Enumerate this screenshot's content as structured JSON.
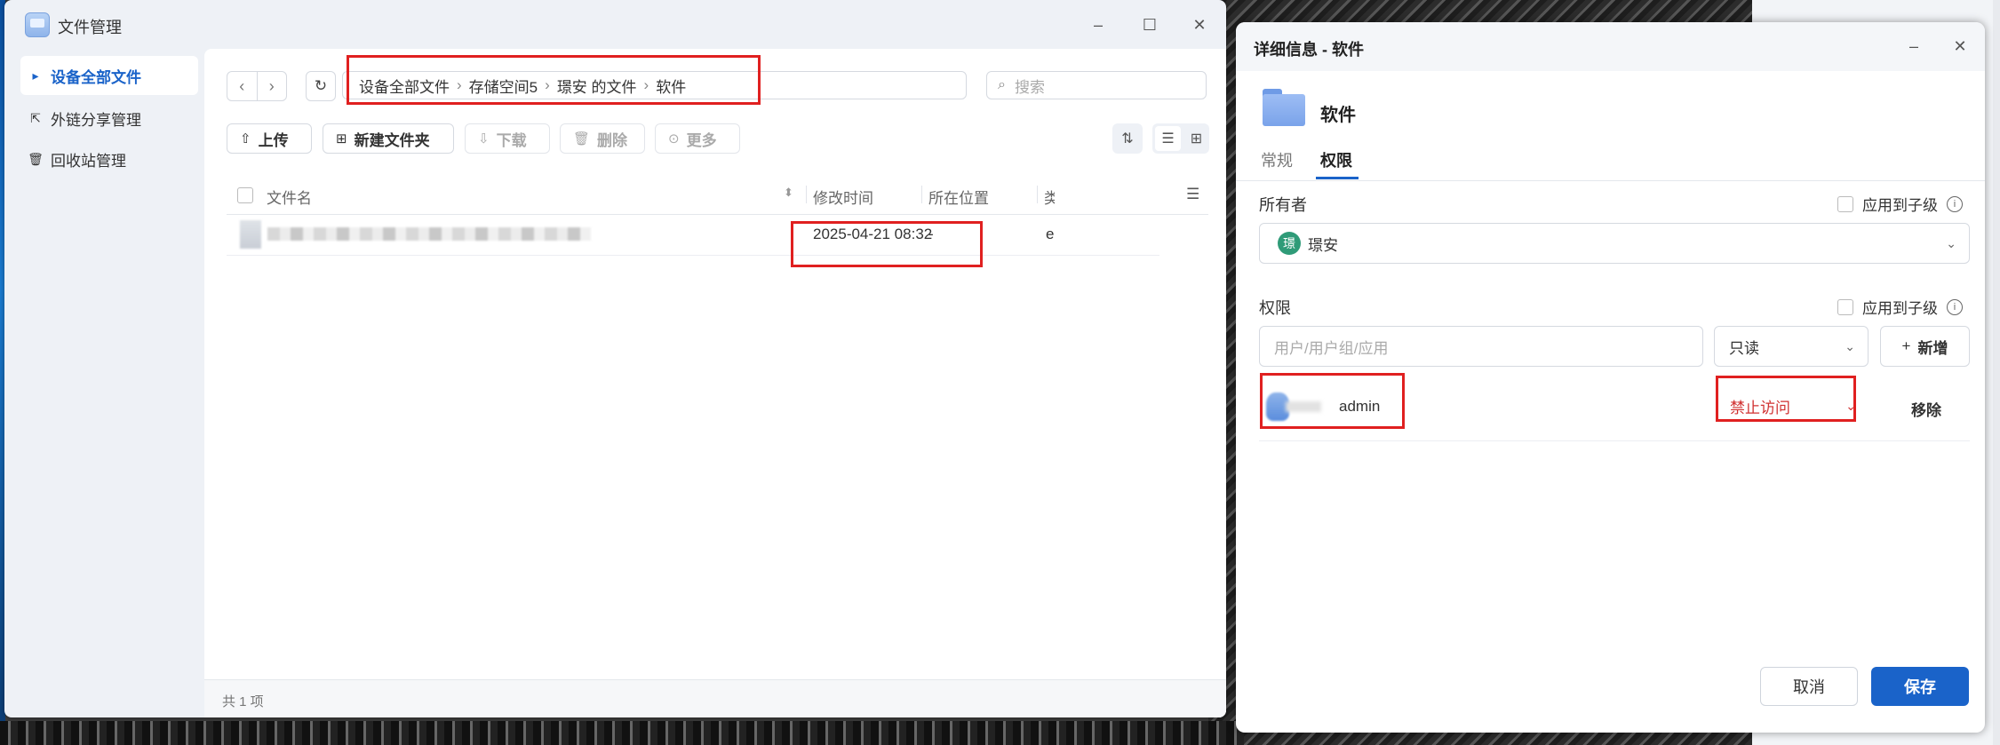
{
  "file_manager": {
    "title": "文件管理",
    "sidebar": [
      {
        "label": "设备全部文件",
        "icon": "caret-right-icon",
        "active": true
      },
      {
        "label": "外链分享管理",
        "icon": "share-link-icon",
        "active": false
      },
      {
        "label": "回收站管理",
        "icon": "trash-icon",
        "active": false
      }
    ],
    "breadcrumb": [
      "设备全部文件",
      "存储空间5",
      "璟安 的文件",
      "软件"
    ],
    "search_placeholder": "搜索",
    "toolbar": {
      "upload": "上传",
      "new_folder": "新建文件夹",
      "download": "下载",
      "delete": "删除",
      "more": "更多"
    },
    "table": {
      "columns": [
        "文件名",
        "修改时间",
        "所在位置",
        "类"
      ],
      "rows": [
        {
          "modified": "2025-04-21 08:32",
          "location": "-",
          "type_partial": "e"
        }
      ]
    },
    "footer": "共 1 项"
  },
  "detail": {
    "title": "详细信息 - 软件",
    "folder_name": "软件",
    "tabs": [
      "常规",
      "权限"
    ],
    "active_tab": "权限",
    "owner_label": "所有者",
    "apply_children": "应用到子级",
    "owner": {
      "initial": "璟",
      "name": "璟安"
    },
    "permission_label": "权限",
    "user_placeholder": "用户/用户组/应用",
    "permission_select": "只读",
    "add_button": "新增",
    "entries": [
      {
        "name": "admin",
        "permission": "禁止访问",
        "remove": "移除"
      }
    ],
    "cancel": "取消",
    "save": "保存"
  },
  "colors": {
    "accent": "#1a63c9",
    "deny": "#d03030",
    "highlight": "#e02020",
    "owner_avatar": "#2f9b78"
  }
}
